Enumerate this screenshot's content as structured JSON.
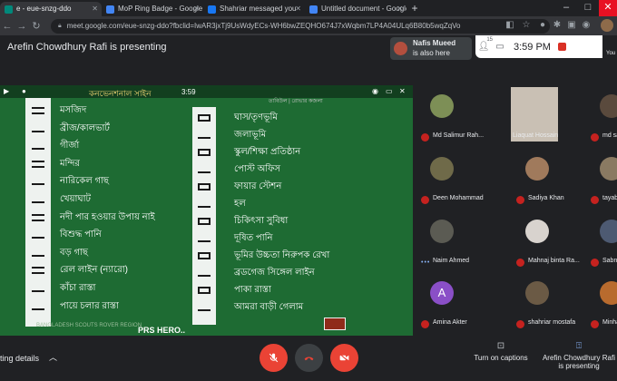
{
  "browser": {
    "tabs": [
      {
        "label": "e - eue-snzg-ddo",
        "favicon_color": "#00897b",
        "active": true
      },
      {
        "label": "MoP Ring Badge - Google Docs",
        "favicon_color": "#4285f4",
        "active": false
      },
      {
        "label": "Shahriar messaged you",
        "favicon_color": "#1877f2",
        "active": false
      },
      {
        "label": "Untitled document - Google Docs",
        "favicon_color": "#4285f4",
        "active": false
      }
    ],
    "new_tab": "+",
    "url": "meet.google.com/eue-snzg-ddo?fbclid=IwAR3jxTj9UsWdyECs-WH6bwZEQHO674J7xWqbm7LP4A04ULq6B80b5wqZqVo"
  },
  "meet": {
    "presenting_title": "Arefin Chowdhury Rafi is presenting",
    "toast": {
      "name": "Nafis Mueed",
      "message": "is also here"
    },
    "participant_count": "15",
    "clock": "3:59 PM",
    "you_label": "You"
  },
  "slide": {
    "heading": "কনভেনশনাল সাইন",
    "time": "3:59",
    "heading2": "তাবিউল | রোভার কজলা",
    "left_items": [
      "মসজিদ",
      "ব্রীজ/কালভার্ট",
      "গীর্জা",
      "মন্দির",
      "নারিকেল গাছ",
      "খেয়াঘাট",
      "নদী পার হওয়ার উপায় নাই",
      "বিশুদ্ধ পানি",
      "বড় গাছ",
      "রেল লাইন (ন্যারো)",
      "কাঁচা রাস্তা",
      "পায়ে চলার রাস্তা"
    ],
    "right_items": [
      "ঘাস/তৃণভূমি",
      "জলাভূমি",
      "স্কুল/শিক্ষা প্রতিষ্ঠান",
      "পোস্ট অফিস",
      "ফায়ার স্টেশন",
      "হল",
      "চিকিৎসা সুবিধা",
      "দূষিত পানি",
      "ভূমির উচ্চতা নিরুপক রেখা",
      "ব্রডগেজ সিঙ্গেল লাইন",
      "পাকা রাস্তা",
      "আমরা বাড়ী গেলাম"
    ],
    "footer": "BANGLADESH SCOUTS ROVER REGION",
    "footer2": "PRS HERO.."
  },
  "participants": [
    {
      "name": "Md Salimur Rah...",
      "muted": true,
      "avatar_color": "#7d8f56"
    },
    {
      "name": "Liaquat Hossain",
      "muted": false,
      "avatar_color": "#c9c0b4",
      "video": true
    },
    {
      "name": "md saiful",
      "muted": true,
      "avatar_color": "#5a4a3d"
    },
    {
      "name": "Deen Mohammad",
      "muted": true,
      "avatar_color": "#6f6a49"
    },
    {
      "name": "Sadiya Khan",
      "muted": true,
      "avatar_color": "#a07a5c"
    },
    {
      "name": "tayab sa",
      "muted": true,
      "avatar_color": "#8a7a62"
    },
    {
      "name": "Naim Ahmed",
      "muted": false,
      "avatar_color": "#5b5b53"
    },
    {
      "name": "Mahnaj binta Ra...",
      "muted": true,
      "avatar_color": "#d8d3ce"
    },
    {
      "name": "Sabnaz A",
      "muted": true,
      "avatar_color": "#4d5a72"
    },
    {
      "name": "Amina Akter",
      "muted": true,
      "avatar_color": "#8a4fc7",
      "initial": "A"
    },
    {
      "name": "shahriar mostafa",
      "muted": true,
      "avatar_color": "#6b5a45"
    },
    {
      "name": "Minha M",
      "muted": true,
      "avatar_color": "#b86b2e"
    }
  ],
  "bottom": {
    "meeting_details": "ting details",
    "captions_label": "Turn on captions",
    "presenting_label_line1": "Arefin Chowdhury Rafi",
    "presenting_label_line2": "is presenting"
  },
  "colors": {
    "meet_bg": "#202124",
    "slide_green": "#1e6b33",
    "control_red": "#ea4335"
  }
}
